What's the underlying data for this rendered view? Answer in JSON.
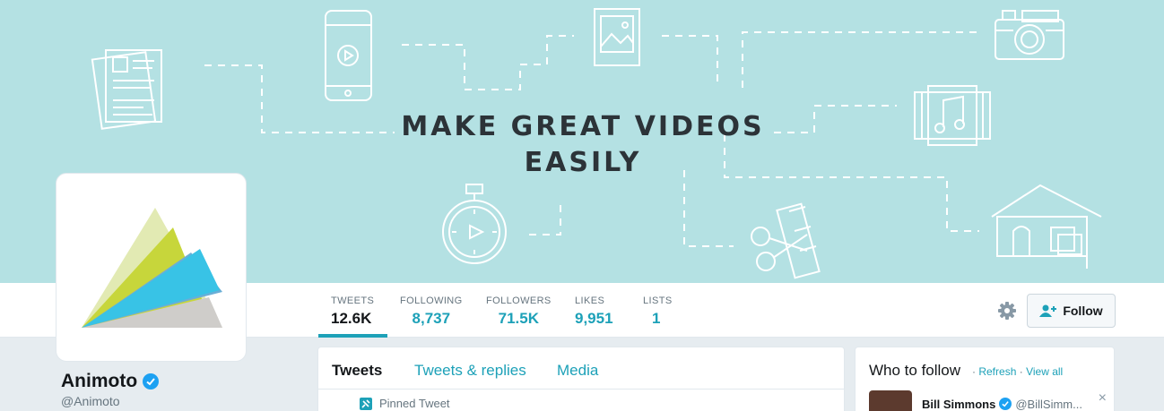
{
  "banner": {
    "headline_line1": "MAKE GREAT VIDEOS",
    "headline_line2": "EASILY",
    "background_color": "#b4e1e3"
  },
  "profile": {
    "name": "Animoto",
    "handle": "@Animoto",
    "verified": true
  },
  "stats": [
    {
      "label": "TWEETS",
      "value": "12.6K"
    },
    {
      "label": "FOLLOWING",
      "value": "8,737"
    },
    {
      "label": "FOLLOWERS",
      "value": "71.5K"
    },
    {
      "label": "LIKES",
      "value": "9,951"
    },
    {
      "label": "LISTS",
      "value": "1"
    }
  ],
  "actions": {
    "follow_label": "Follow",
    "settings_icon": "gear-icon"
  },
  "timeline": {
    "tabs": [
      {
        "label": "Tweets",
        "active": true
      },
      {
        "label": "Tweets & replies"
      },
      {
        "label": "Media"
      }
    ],
    "pinned_label": "Pinned Tweet"
  },
  "who_to_follow": {
    "title": "Who to follow",
    "separator": "·",
    "refresh_label": "Refresh",
    "view_all_label": "View all",
    "users": [
      {
        "name": "Bill Simmons",
        "handle": "@BillSimm...",
        "verified": true
      }
    ],
    "close_glyph": "×"
  },
  "colors": {
    "accent": "#1da1b8",
    "text": "#14171a",
    "muted": "#66757f"
  }
}
